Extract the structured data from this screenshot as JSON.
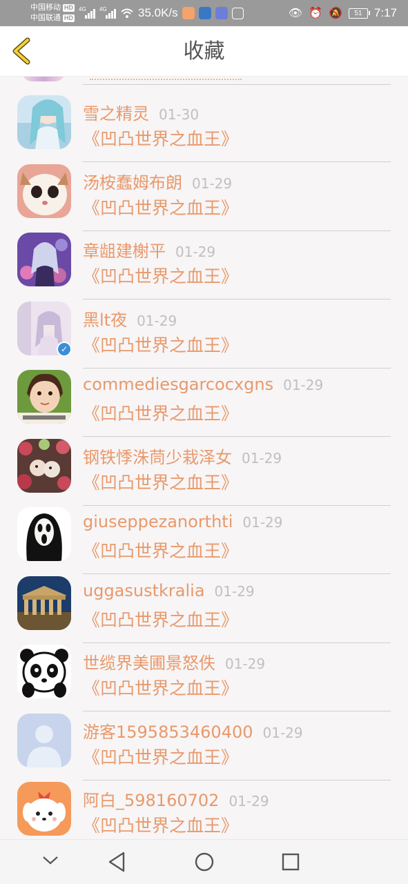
{
  "status_bar": {
    "carrier1": "中国移动",
    "carrier2": "中国联通",
    "hd_badge": "HD",
    "net_type1": "4G",
    "net_type2": "4G",
    "speed": "35.0K/s",
    "battery": "51",
    "time": "7:17"
  },
  "header": {
    "title": "收藏"
  },
  "items": [
    {
      "name": "雪之精灵",
      "date": "01-30",
      "book": "《凹凸世界之血王》",
      "avatar": "anime-girl-blue",
      "verified": false
    },
    {
      "name": "汤桉蠢姆布朗",
      "date": "01-29",
      "book": "《凹凸世界之血王》",
      "avatar": "cat",
      "verified": false
    },
    {
      "name": "章龃建榭平",
      "date": "01-29",
      "book": "《凹凸世界之血王》",
      "avatar": "anime-girl-flowers",
      "verified": false
    },
    {
      "name": "黑lt夜",
      "date": "01-29",
      "book": "《凹凸世界之血王》",
      "avatar": "girl-pale",
      "verified": true
    },
    {
      "name": "commediesgarcocxgns",
      "date": "01-29",
      "book": "《凹凸世界之血王》",
      "avatar": "girl-photo",
      "verified": false
    },
    {
      "name": "钢铁悸洙茼少栽泽女",
      "date": "01-29",
      "book": "《凹凸世界之血王》",
      "avatar": "roses-dolls",
      "verified": false
    },
    {
      "name": "giuseppezanorthti",
      "date": "01-29",
      "book": "《凹凸世界之血王》",
      "avatar": "scream-mask",
      "verified": false
    },
    {
      "name": "uggasustkralia",
      "date": "01-29",
      "book": "《凹凸世界之血王》",
      "avatar": "parthenon",
      "verified": false
    },
    {
      "name": "世缆界美圃景怒佚",
      "date": "01-29",
      "book": "《凹凸世界之血王》",
      "avatar": "panda",
      "verified": false
    },
    {
      "name": "游客1595853460400",
      "date": "01-29",
      "book": "《凹凸世界之血王》",
      "avatar": "default-user",
      "verified": false
    },
    {
      "name": "阿白_598160702",
      "date": "01-29",
      "book": "《凹凸世界之血王》",
      "avatar": "puppy-cartoon",
      "verified": false
    }
  ],
  "nav": {
    "icons": [
      "chevron-down-icon",
      "back-triangle-icon",
      "home-circle-icon",
      "recents-square-icon"
    ]
  }
}
